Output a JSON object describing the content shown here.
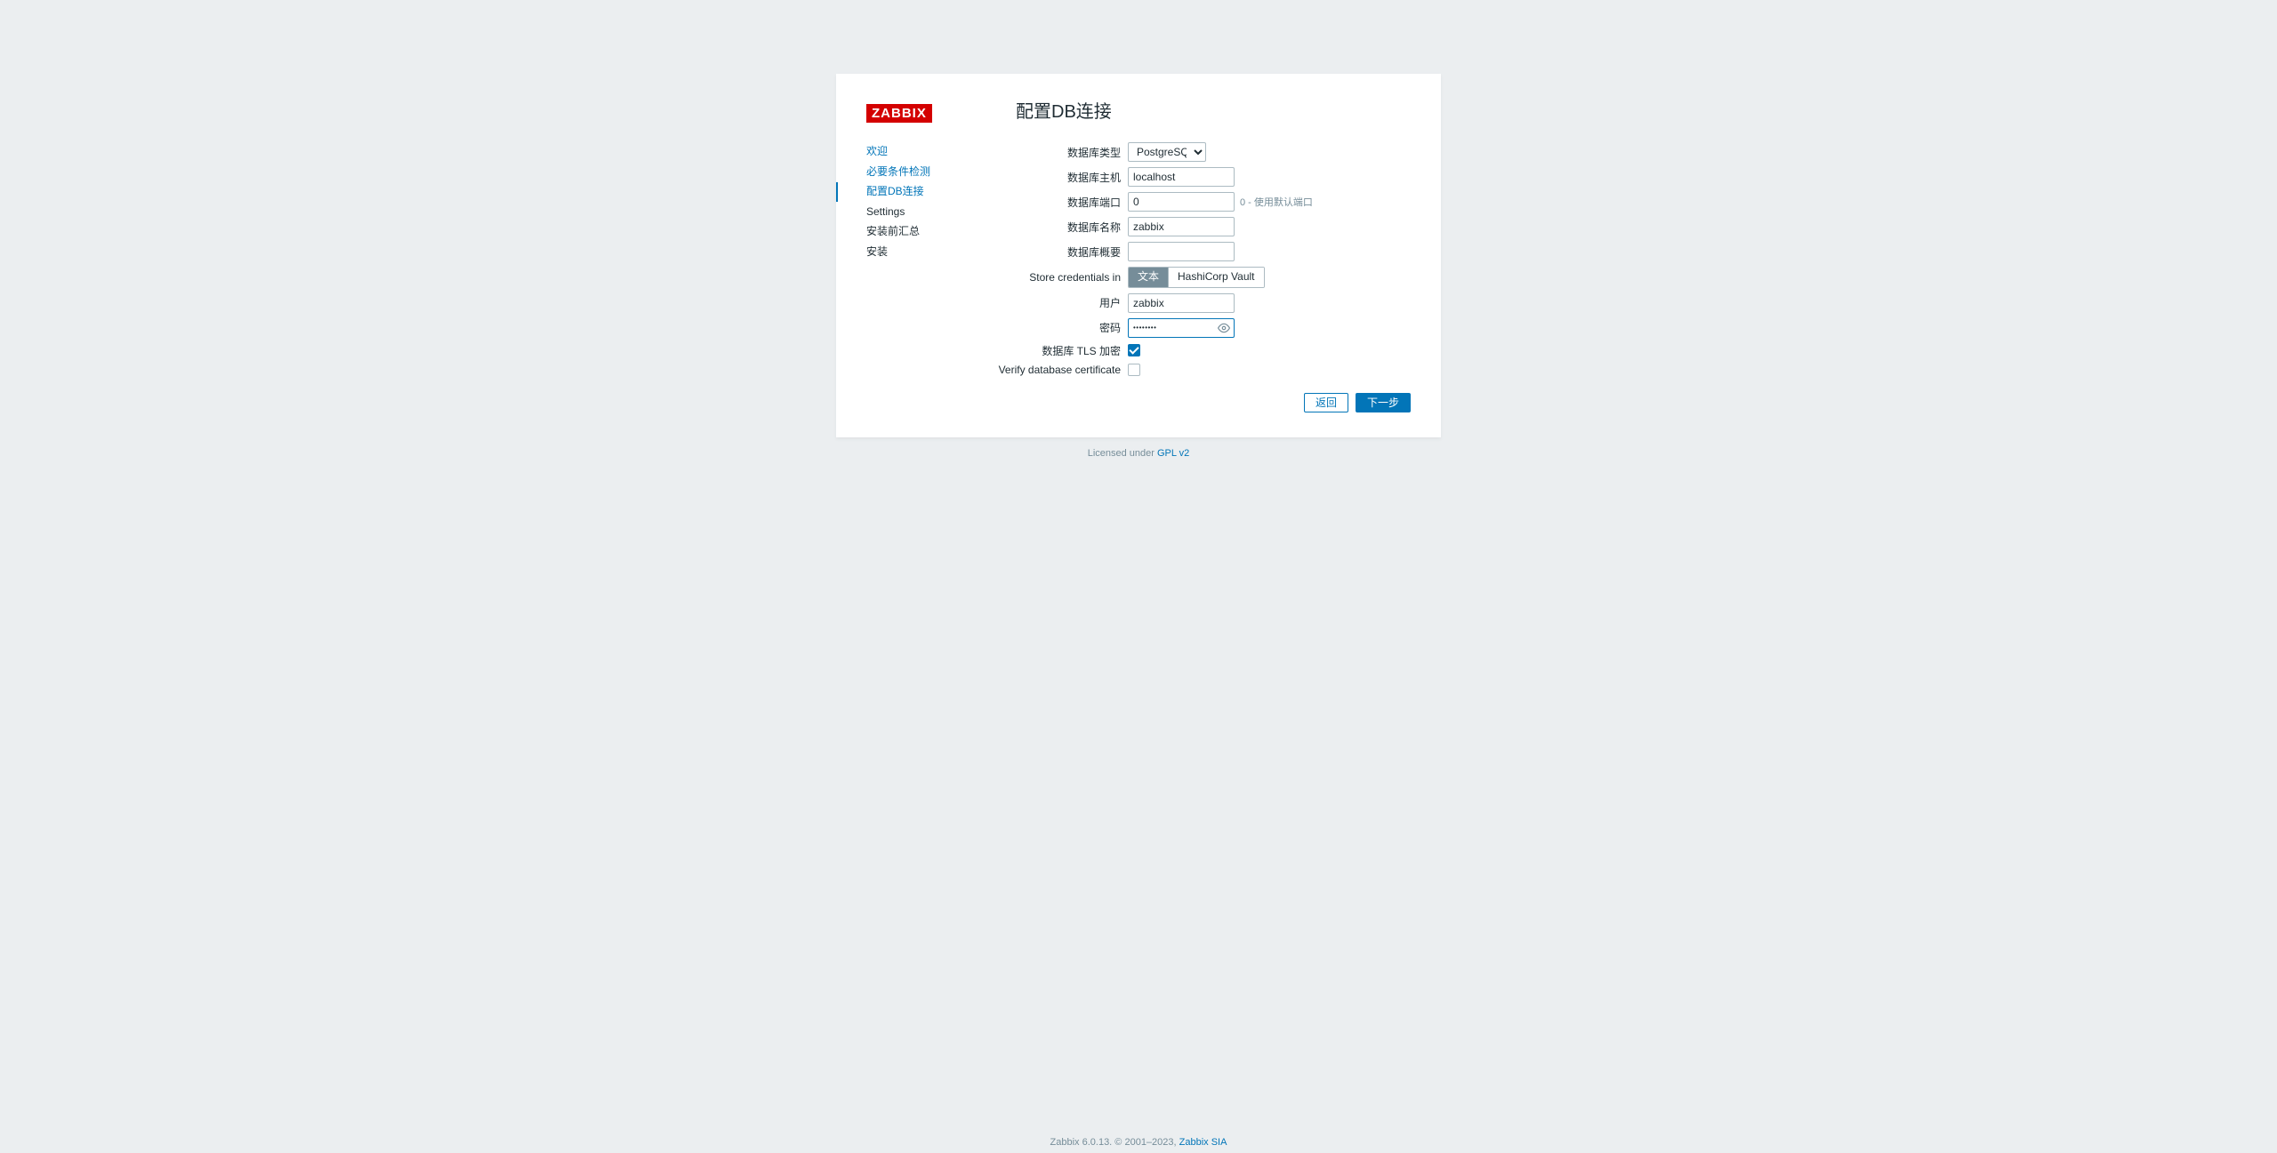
{
  "logo_text": "ZABBIX",
  "page_title": "配置DB连接",
  "sidebar": {
    "items": [
      {
        "label": "欢迎",
        "state": "completed"
      },
      {
        "label": "必要条件检测",
        "state": "completed"
      },
      {
        "label": "配置DB连接",
        "state": "selected"
      },
      {
        "label": "Settings",
        "state": "pending"
      },
      {
        "label": "安装前汇总",
        "state": "pending"
      },
      {
        "label": "安装",
        "state": "pending"
      }
    ]
  },
  "form": {
    "db_type_label": "数据库类型",
    "db_type_value": "PostgreSQL",
    "db_host_label": "数据库主机",
    "db_host_value": "localhost",
    "db_port_label": "数据库端口",
    "db_port_value": "0",
    "db_port_hint": "0 - 使用默认端口",
    "db_name_label": "数据库名称",
    "db_name_value": "zabbix",
    "db_schema_label": "数据库概要",
    "db_schema_value": "",
    "store_cred_label": "Store credentials in",
    "store_cred_option1": "文本",
    "store_cred_option2": "HashiCorp Vault",
    "user_label": "用户",
    "user_value": "zabbix",
    "password_label": "密码",
    "password_value": "••••••••",
    "tls_label": "数据库 TLS 加密",
    "tls_checked": true,
    "verify_cert_label": "Verify database certificate",
    "verify_cert_checked": false
  },
  "buttons": {
    "back": "返回",
    "next": "下一步"
  },
  "license": {
    "prefix": "Licensed under ",
    "link_text": "GPL v2"
  },
  "footer": {
    "prefix": "Zabbix 6.0.13. © 2001–2023, ",
    "link_text": "Zabbix SIA"
  }
}
